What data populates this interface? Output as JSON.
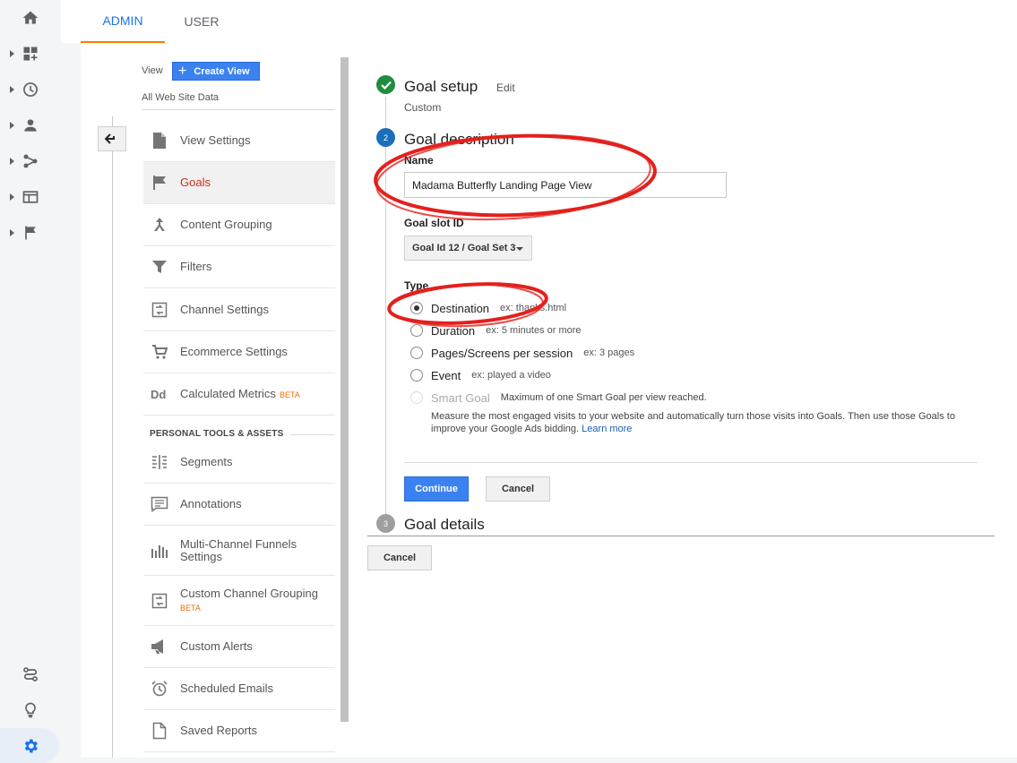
{
  "rail": {
    "icons": [
      "home-icon",
      "customization-icon",
      "realtime-icon",
      "audience-icon",
      "acquisition-icon",
      "behavior-icon",
      "conversions-icon",
      "attribution-icon",
      "discover-icon",
      "admin-icon"
    ],
    "active_color": "#1a73e8"
  },
  "tabs": [
    {
      "label": "ADMIN",
      "active": true
    },
    {
      "label": "USER",
      "active": false
    }
  ],
  "view": {
    "label": "View",
    "create_button": "Create View",
    "name": "All Web Site Data"
  },
  "nav": {
    "items": [
      {
        "label": "View Settings",
        "icon": "document-icon"
      },
      {
        "label": "Goals",
        "icon": "flag-icon",
        "active": true
      },
      {
        "label": "Content Grouping",
        "icon": "grouping-icon"
      },
      {
        "label": "Filters",
        "icon": "filter-icon"
      },
      {
        "label": "Channel Settings",
        "icon": "channel-icon"
      },
      {
        "label": "Ecommerce Settings",
        "icon": "cart-icon"
      },
      {
        "label": "Calculated Metrics",
        "icon": "calculated-metrics-icon",
        "badge": "BETA"
      }
    ],
    "section_title": "PERSONAL TOOLS & ASSETS",
    "personal_items": [
      {
        "label": "Segments",
        "icon": "segments-icon"
      },
      {
        "label": "Annotations",
        "icon": "annotations-icon"
      },
      {
        "label": "Multi-Channel Funnels Settings",
        "icon": "funnels-icon"
      },
      {
        "label": "Custom Channel Grouping",
        "icon": "custom-channel-icon",
        "badge": "BETA"
      },
      {
        "label": "Custom Alerts",
        "icon": "megaphone-icon"
      },
      {
        "label": "Scheduled Emails",
        "icon": "alarm-clock-icon"
      },
      {
        "label": "Saved Reports",
        "icon": "saved-reports-icon"
      }
    ]
  },
  "goal": {
    "setup": {
      "number_done": "check-icon",
      "title": "Goal setup",
      "edit": "Edit",
      "sub": "Custom"
    },
    "description": {
      "number": "2",
      "title": "Goal description",
      "name_label": "Name",
      "name_value": "Madama Butterfly Landing Page View",
      "slot_label": "Goal slot ID",
      "slot_value": "Goal Id 12 / Goal Set 3",
      "type_label": "Type",
      "types": [
        {
          "label": "Destination",
          "example": "ex: thanks.html",
          "checked": true
        },
        {
          "label": "Duration",
          "example": "ex: 5 minutes or more",
          "checked": false
        },
        {
          "label": "Pages/Screens per session",
          "example": "ex: 3 pages",
          "checked": false
        },
        {
          "label": "Event",
          "example": "ex: played a video",
          "checked": false
        },
        {
          "label": "Smart Goal",
          "example": "Maximum of one Smart Goal per view reached.",
          "checked": false,
          "disabled": true
        }
      ],
      "smart_desc": "Measure the most engaged visits to your website and automatically turn those visits into Goals. Then use those Goals to improve your Google Ads bidding.",
      "learn_more": "Learn more",
      "continue": "Continue",
      "cancel": "Cancel"
    },
    "details": {
      "number": "3",
      "title": "Goal details"
    },
    "cancel": "Cancel"
  },
  "annotation_color": "#e4201d"
}
